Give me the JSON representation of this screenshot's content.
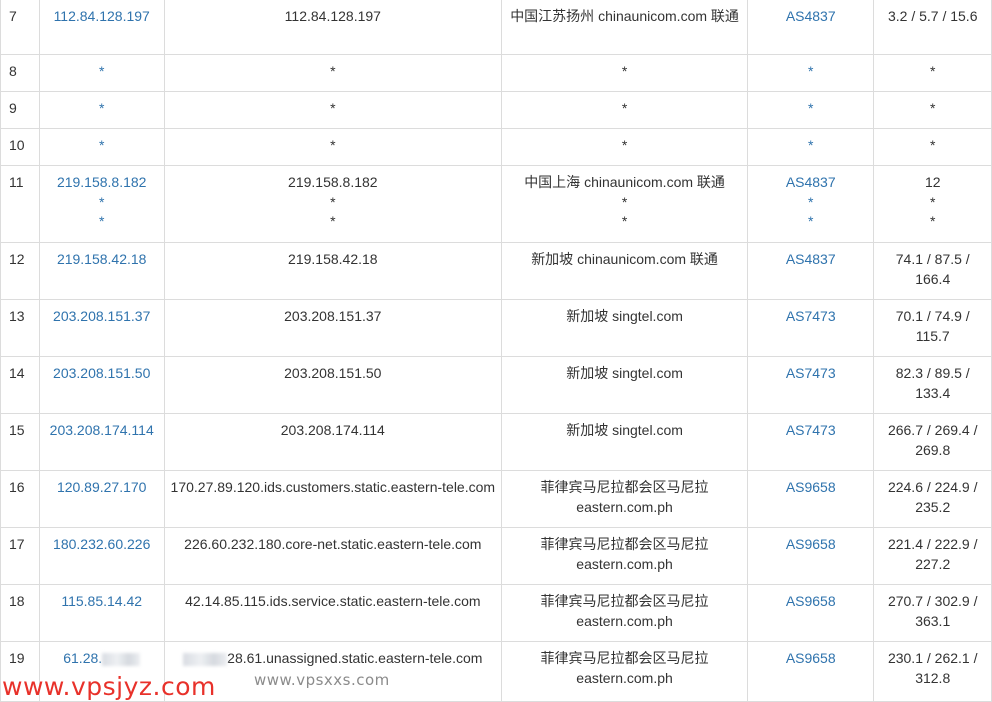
{
  "rows": [
    {
      "hop": "7",
      "ip": "112.84.128.197",
      "host": "112.84.128.197",
      "location": "中国江苏扬州 chinaunicom.com 联通",
      "asn": "AS4837",
      "latency": "3.2 / 5.7 / 15.6"
    },
    {
      "hop": "8",
      "ip": "*",
      "host": "*",
      "location": "*",
      "asn": "*",
      "latency": "*"
    },
    {
      "hop": "9",
      "ip": "*",
      "host": "*",
      "location": "*",
      "asn": "*",
      "latency": "*"
    },
    {
      "hop": "10",
      "ip": "*",
      "host": "*",
      "location": "*",
      "asn": "*",
      "latency": "*"
    },
    {
      "hop": "11",
      "ip": "219.158.8.182",
      "host": "219.158.8.182",
      "location": "中国上海 chinaunicom.com 联通",
      "asn": "AS4837",
      "latency": "12",
      "extra": [
        {
          "ip": "*",
          "host": "*",
          "location": "*",
          "asn": "*",
          "latency": "*"
        },
        {
          "ip": "*",
          "host": "*",
          "location": "*",
          "asn": "*",
          "latency": "*"
        }
      ]
    },
    {
      "hop": "12",
      "ip": "219.158.42.18",
      "host": "219.158.42.18",
      "location": "新加坡 chinaunicom.com 联通",
      "asn": "AS4837",
      "latency": "74.1 / 87.5 / 166.4"
    },
    {
      "hop": "13",
      "ip": "203.208.151.37",
      "host": "203.208.151.37",
      "location": "新加坡 singtel.com",
      "asn": "AS7473",
      "latency": "70.1 / 74.9 / 115.7"
    },
    {
      "hop": "14",
      "ip": "203.208.151.50",
      "host": "203.208.151.50",
      "location": "新加坡 singtel.com",
      "asn": "AS7473",
      "latency": "82.3 / 89.5 / 133.4"
    },
    {
      "hop": "15",
      "ip": "203.208.174.114",
      "host": "203.208.174.114",
      "location": "新加坡 singtel.com",
      "asn": "AS7473",
      "latency": "266.7 / 269.4 / 269.8"
    },
    {
      "hop": "16",
      "ip": "120.89.27.170",
      "host": "170.27.89.120.ids.customers.static.eastern-tele.com",
      "location": "菲律宾马尼拉都会区马尼拉 eastern.com.ph",
      "asn": "AS9658",
      "latency": "224.6 / 224.9 / 235.2"
    },
    {
      "hop": "17",
      "ip": "180.232.60.226",
      "host": "226.60.232.180.core-net.static.eastern-tele.com",
      "location": "菲律宾马尼拉都会区马尼拉 eastern.com.ph",
      "asn": "AS9658",
      "latency": "221.4 / 222.9 / 227.2"
    },
    {
      "hop": "18",
      "ip": "115.85.14.42",
      "host": "42.14.85.115.ids.service.static.eastern-tele.com",
      "location": "菲律宾马尼拉都会区马尼拉 eastern.com.ph",
      "asn": "AS9658",
      "latency": "270.7 / 302.9 / 363.1"
    },
    {
      "hop": "19",
      "ip": "61.28.",
      "host": "28.61.unassigned.static.eastern-tele.com",
      "location": "菲律宾马尼拉都会区马尼拉 eastern.com.ph",
      "asn": "AS9658",
      "latency": "230.1 / 262.1 / 312.8",
      "redacted": true
    }
  ],
  "watermarks": {
    "primary": "www.vpsjyz.com",
    "secondary": "www.vpsxxs.com"
  }
}
